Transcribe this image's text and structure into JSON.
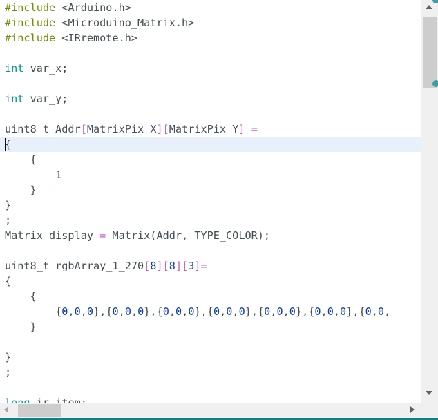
{
  "editor": {
    "language": "Arduino C++",
    "highlighted_line": 10,
    "lines": [
      {
        "tokens": [
          {
            "t": "#include",
            "c": "pp"
          },
          {
            "t": " <Arduino.h>",
            "c": "punct"
          }
        ]
      },
      {
        "tokens": [
          {
            "t": "#include",
            "c": "pp"
          },
          {
            "t": " <Microduino_Matrix.h>",
            "c": "punct"
          }
        ]
      },
      {
        "tokens": [
          {
            "t": "#include",
            "c": "pp"
          },
          {
            "t": " <IRremote.h>",
            "c": "punct"
          }
        ]
      },
      {
        "tokens": []
      },
      {
        "tokens": [
          {
            "t": "int",
            "c": "kw"
          },
          {
            "t": " var_x;",
            "c": "punct"
          }
        ]
      },
      {
        "tokens": []
      },
      {
        "tokens": [
          {
            "t": "int",
            "c": "kw"
          },
          {
            "t": " var_y;",
            "c": "punct"
          }
        ]
      },
      {
        "tokens": []
      },
      {
        "tokens": [
          {
            "t": "uint8_t Addr",
            "c": "punct"
          },
          {
            "t": "[",
            "c": "op"
          },
          {
            "t": "MatrixPix_X",
            "c": "punct"
          },
          {
            "t": "][",
            "c": "op"
          },
          {
            "t": "MatrixPix_Y",
            "c": "punct"
          },
          {
            "t": "]",
            "c": "op"
          },
          {
            "t": " ",
            "c": "punct"
          },
          {
            "t": "=",
            "c": "op"
          }
        ]
      },
      {
        "tokens": [
          {
            "t": "{",
            "c": "punct"
          }
        ]
      },
      {
        "tokens": [
          {
            "t": "    {",
            "c": "punct"
          }
        ]
      },
      {
        "tokens": [
          {
            "t": "        ",
            "c": "punct"
          },
          {
            "t": "1",
            "c": "num"
          }
        ]
      },
      {
        "tokens": [
          {
            "t": "    }",
            "c": "punct"
          }
        ]
      },
      {
        "tokens": [
          {
            "t": "}",
            "c": "punct"
          }
        ]
      },
      {
        "tokens": [
          {
            "t": ";",
            "c": "punct"
          }
        ]
      },
      {
        "tokens": [
          {
            "t": "Matrix display ",
            "c": "punct"
          },
          {
            "t": "=",
            "c": "op"
          },
          {
            "t": " Matrix(Addr, TYPE_COLOR);",
            "c": "punct"
          }
        ]
      },
      {
        "tokens": []
      },
      {
        "tokens": [
          {
            "t": "uint8_t rgbArray_1_270",
            "c": "punct"
          },
          {
            "t": "[",
            "c": "op"
          },
          {
            "t": "8",
            "c": "num"
          },
          {
            "t": "][",
            "c": "op"
          },
          {
            "t": "8",
            "c": "num"
          },
          {
            "t": "][",
            "c": "op"
          },
          {
            "t": "3",
            "c": "num"
          },
          {
            "t": "]=",
            "c": "op"
          }
        ]
      },
      {
        "tokens": [
          {
            "t": "{",
            "c": "punct"
          }
        ]
      },
      {
        "tokens": [
          {
            "t": "    {",
            "c": "punct"
          }
        ]
      },
      {
        "tokens": [
          {
            "t": "        {",
            "c": "punct"
          },
          {
            "t": "0",
            "c": "num"
          },
          {
            "t": ",",
            "c": "punct"
          },
          {
            "t": "0",
            "c": "num"
          },
          {
            "t": ",",
            "c": "punct"
          },
          {
            "t": "0",
            "c": "num"
          },
          {
            "t": "},{",
            "c": "punct"
          },
          {
            "t": "0",
            "c": "num"
          },
          {
            "t": ",",
            "c": "punct"
          },
          {
            "t": "0",
            "c": "num"
          },
          {
            "t": ",",
            "c": "punct"
          },
          {
            "t": "0",
            "c": "num"
          },
          {
            "t": "},{",
            "c": "punct"
          },
          {
            "t": "0",
            "c": "num"
          },
          {
            "t": ",",
            "c": "punct"
          },
          {
            "t": "0",
            "c": "num"
          },
          {
            "t": ",",
            "c": "punct"
          },
          {
            "t": "0",
            "c": "num"
          },
          {
            "t": "},{",
            "c": "punct"
          },
          {
            "t": "0",
            "c": "num"
          },
          {
            "t": ",",
            "c": "punct"
          },
          {
            "t": "0",
            "c": "num"
          },
          {
            "t": ",",
            "c": "punct"
          },
          {
            "t": "0",
            "c": "num"
          },
          {
            "t": "},{",
            "c": "punct"
          },
          {
            "t": "0",
            "c": "num"
          },
          {
            "t": ",",
            "c": "punct"
          },
          {
            "t": "0",
            "c": "num"
          },
          {
            "t": ",",
            "c": "punct"
          },
          {
            "t": "0",
            "c": "num"
          },
          {
            "t": "},{",
            "c": "punct"
          },
          {
            "t": "0",
            "c": "num"
          },
          {
            "t": ",",
            "c": "punct"
          },
          {
            "t": "0",
            "c": "num"
          },
          {
            "t": ",",
            "c": "punct"
          },
          {
            "t": "0",
            "c": "num"
          },
          {
            "t": "},{",
            "c": "punct"
          },
          {
            "t": "0",
            "c": "num"
          },
          {
            "t": ",",
            "c": "punct"
          },
          {
            "t": "0",
            "c": "num"
          },
          {
            "t": ",",
            "c": "punct"
          }
        ]
      },
      {
        "tokens": [
          {
            "t": "    }",
            "c": "punct"
          }
        ]
      },
      {
        "tokens": []
      },
      {
        "tokens": [
          {
            "t": "}",
            "c": "punct"
          }
        ]
      },
      {
        "tokens": [
          {
            "t": ";",
            "c": "punct"
          }
        ]
      },
      {
        "tokens": []
      },
      {
        "tokens": [
          {
            "t": "long",
            "c": "kw"
          },
          {
            "t": " ir_item;",
            "c": "punct"
          }
        ]
      }
    ]
  },
  "scrollbars": {
    "vertical": {
      "up_icon": "arrow-up-icon",
      "down_icon": "arrow-down-icon"
    },
    "horizontal": {
      "left_icon": "arrow-left-icon",
      "right_icon": "arrow-right-icon"
    }
  },
  "colors": {
    "preprocessor": "#728e00",
    "keyword": "#00979c",
    "number": "#0c3cae",
    "operator": "#c15ec5",
    "text": "#434f54",
    "line_highlight": "#e7f0fb",
    "accent": "#0e7f86"
  }
}
